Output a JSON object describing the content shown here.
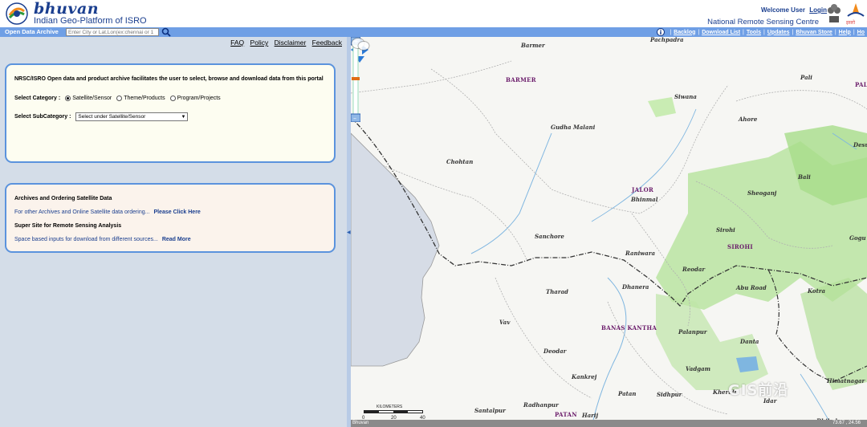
{
  "header": {
    "logo_text": "bhuvan",
    "logo_subtitle": "Indian Geo-Platform of ISRO",
    "welcome": "Welcome User",
    "login": "Login",
    "org": "National Remote Sensing Centre"
  },
  "toolbar": {
    "label": "Open Data Archive",
    "search_placeholder": "Enter City or Lat,Lon(ex:chennai or 1",
    "links": [
      "Backlog",
      "Download List",
      "Tools",
      "Updates",
      "Bhuvan Store",
      "Help",
      "Ho"
    ]
  },
  "left": {
    "links": [
      "FAQ",
      "Policy",
      "Disclaimer",
      "Feedback"
    ],
    "intro": "NRSC/ISRO Open data and product archive facilitates the user to select, browse and download data from this portal",
    "category_label": "Select Category :",
    "categories": [
      "Satellite/Sensor",
      "Theme/Products",
      "Program/Projects"
    ],
    "selected_category": "Satellite/Sensor",
    "subcategory_label": "Select SubCategory :",
    "subcategory_value": "Select under Satellite/Sensor",
    "archives_heading": "Archives and Ordering Satellite Data",
    "archives_text": "For other Archives and Online Satellite data ordering...",
    "archives_link": "Please Click Here",
    "supersite_heading": "Super Site for Remote Sensing Analysis",
    "supersite_text": "Space based inputs for download from different sources...",
    "supersite_link": "Read More"
  },
  "map": {
    "places": [
      "Barmer",
      "Pachpadra",
      "Pali",
      "Siwana",
      "Ahore",
      "Desu",
      "Gudha Malani",
      "Chohtan",
      "Bali",
      "Bhinmal",
      "Sheoganj",
      "Sirohi",
      "Gogu",
      "Sanchore",
      "Raniwara",
      "Reodar",
      "Abu Road",
      "Kotra",
      "Tharad",
      "Dhanera",
      "Vav",
      "Palanpur",
      "Danta",
      "Deodar",
      "Vadgam",
      "Kankrej",
      "Patan",
      "Sidhpur",
      "Kheralu",
      "Santalpur",
      "Radhanpur",
      "Harij",
      "Idar",
      "Himatnagar",
      "Bhiloda"
    ],
    "districts": [
      "BARMER",
      "PALI",
      "JALOR",
      "SIROHI",
      "BANAS KANTHA",
      "PATAN"
    ],
    "scale_unit": "KILOMETERS",
    "scale_ticks": [
      "0",
      "20",
      "40"
    ],
    "footer_left": "Bhuvan",
    "footer_right": "73.67 , 24.56",
    "watermark": "GIS前沿"
  }
}
